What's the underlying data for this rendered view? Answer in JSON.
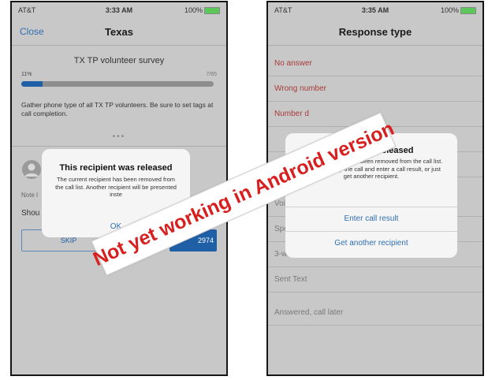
{
  "left_phone": {
    "status": {
      "carrier": "AT&T",
      "time": "3:33 AM",
      "battery": "100%"
    },
    "nav": {
      "close": "Close",
      "title": "Texas"
    },
    "survey_title": "TX TP volunteer survey",
    "progress": {
      "percent_label": "11%",
      "count": "7/65",
      "fraction": 0.11
    },
    "intro": "Gather phone type of all TX TP volunteers. Be sure to set tags at call completion.",
    "dots": "•••",
    "note_label": "Note l",
    "question": "Shou",
    "skip_label": "SKIP",
    "call_label": "2974",
    "modal": {
      "title": "This recipient was released",
      "message": "The current recipient has been removed from the call list. Another recipient will be presented inste",
      "ok": "OK"
    }
  },
  "right_phone": {
    "status": {
      "carrier": "AT&T",
      "time": "3:35 AM",
      "battery": "100%"
    },
    "nav": {
      "title": "Response type"
    },
    "rows": [
      {
        "label": "No answer",
        "style": "red"
      },
      {
        "label": "Wrong number",
        "style": "red"
      },
      {
        "label": "Number d",
        "style": "red"
      },
      {
        "label": "",
        "style": "gray"
      },
      {
        "label": "",
        "style": "gray"
      },
      {
        "label": "Voice",
        "style": "gray"
      },
      {
        "label": "Spok",
        "style": "gray"
      },
      {
        "label": "3-way",
        "style": "gray"
      },
      {
        "label": "Sent Text",
        "style": "gray"
      },
      {
        "label": "Answered, call later",
        "style": "gray"
      }
    ],
    "modal": {
      "title": "cipient was released",
      "message": "e current recipient has been removed from the call list. Please wrap up the call and enter a call result, or just get another recipient.",
      "options": [
        "Enter call result",
        "Get another recipient"
      ]
    }
  },
  "banner": "Not yet working in Android version",
  "colors": {
    "accent": "#1f5fa5",
    "red_text": "#a83a3a",
    "banner_red": "#d81f1f"
  }
}
